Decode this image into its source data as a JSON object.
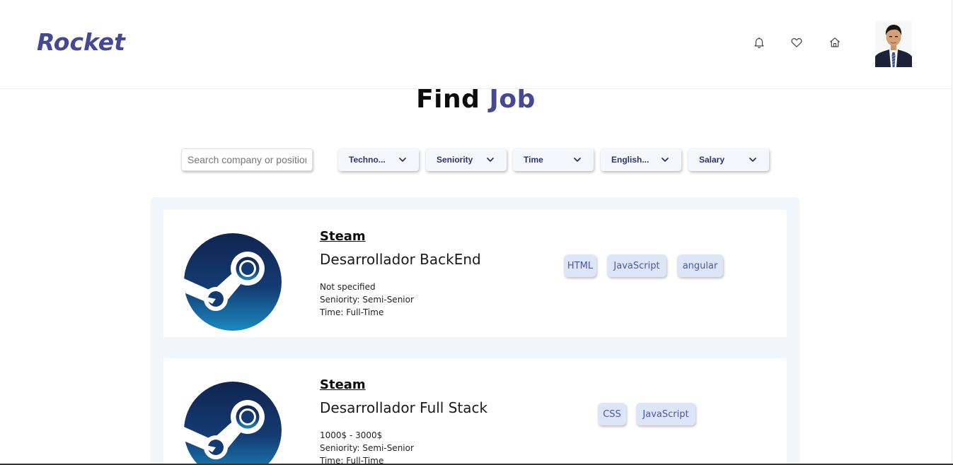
{
  "header": {
    "brand": "Rocket",
    "icons": [
      "bell-icon",
      "heart-icon",
      "home-icon"
    ]
  },
  "main": {
    "title_part1": "Find",
    "title_part2": "Job",
    "search": {
      "placeholder": "Search company or position",
      "value": ""
    },
    "filters": [
      {
        "label": "Techno..."
      },
      {
        "label": "Seniority"
      },
      {
        "label": "Time"
      },
      {
        "label": "English..."
      },
      {
        "label": "Salary"
      }
    ]
  },
  "jobs": [
    {
      "company": "Steam",
      "position": "Desarrollador BackEnd",
      "salary": "Not specified",
      "seniority": "Seniority: Semi-Senior",
      "time": "Time: Full-Time",
      "technologies": [
        "HTML",
        "JavaScript",
        "angular"
      ]
    },
    {
      "company": "Steam",
      "position": "Desarrollador Full Stack",
      "salary": "1000$ - 3000$",
      "seniority": "Seniority: Semi-Senior",
      "time": "Time: Full-Time",
      "technologies": [
        "CSS",
        "JavaScript"
      ]
    }
  ],
  "colors": {
    "brand": "#444895",
    "chip_bg": "#dde6f7",
    "chip_text": "#4a56a8",
    "panel_bg": "#f1f6fa",
    "steam_dark": "#10254f",
    "steam_light": "#1a8ac0"
  }
}
